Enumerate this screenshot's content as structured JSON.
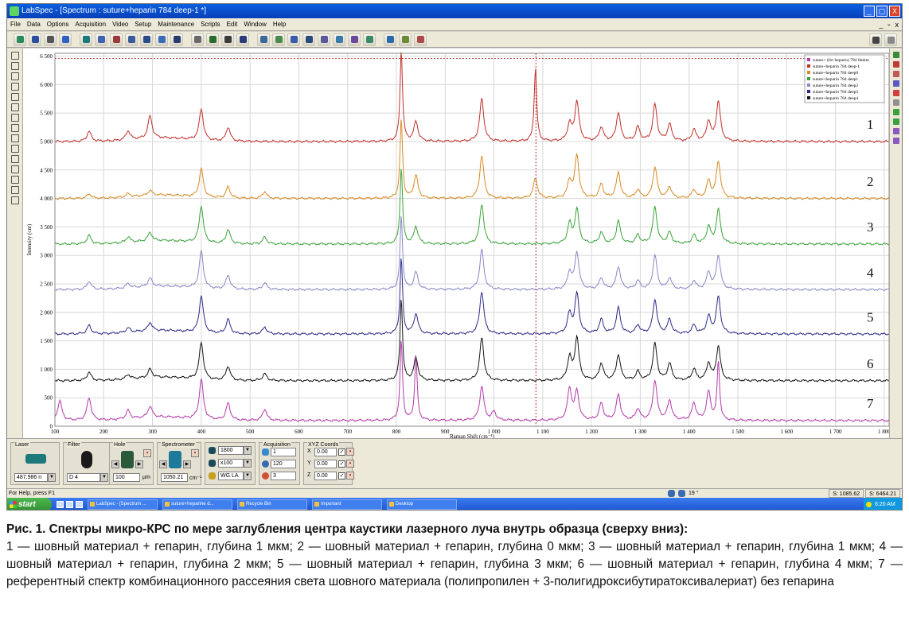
{
  "window": {
    "title": "LabSpec - [Spectrum : suture+heparin 784 deep-1 *]",
    "controls": [
      "_",
      "▢",
      "X"
    ]
  },
  "menu": {
    "items": [
      "File",
      "Data",
      "Options",
      "Acquisition",
      "Video",
      "Setup",
      "Maintenance",
      "Scripts",
      "Edit",
      "Window",
      "Help"
    ],
    "mdi_controls": [
      "_",
      "▫",
      "x"
    ]
  },
  "chart_data": {
    "type": "line",
    "xlabel": "Raman Shift (cm⁻¹)",
    "ylabel": "Intensity (cnt)",
    "xlim": [
      100,
      1810
    ],
    "ylim": [
      0,
      6550
    ],
    "x_ticks": [
      100,
      200,
      300,
      400,
      500,
      600,
      700,
      800,
      900,
      1000,
      1100,
      1200,
      1300,
      1400,
      1500,
      1600,
      1700,
      1800
    ],
    "x_tick_labels": [
      "100",
      "200",
      "300",
      "400",
      "500",
      "600",
      "700",
      "800",
      "900",
      "1 000",
      "1 100",
      "1 200",
      "1 300",
      "1 400",
      "1 500",
      "1 600",
      "1 700",
      "1 800"
    ],
    "y_ticks": [
      0,
      500,
      1000,
      1500,
      2000,
      2500,
      3000,
      3500,
      4000,
      4500,
      5000,
      5500,
      6000,
      6500
    ],
    "y_tick_labels": [
      "0",
      "500",
      "1 000",
      "1 500",
      "2 000",
      "2 500",
      "3 000",
      "3 500",
      "4 000",
      "4 500",
      "5 000",
      "5 500",
      "6 000",
      "6 500"
    ],
    "grid": true,
    "cursor_x": 1086,
    "legend_position": "top-right",
    "series": [
      {
        "name": "suture+heparin 784 deep-1",
        "label": "1",
        "color": "#c0302a",
        "baseline": 5000,
        "scale": 1.0,
        "peaks": [
          [
            170,
            180
          ],
          [
            250,
            160
          ],
          [
            295,
            400
          ],
          [
            400,
            550
          ],
          [
            455,
            250
          ],
          [
            810,
            1600
          ],
          [
            840,
            350
          ],
          [
            975,
            750
          ],
          [
            1085,
            1300
          ],
          [
            1155,
            300
          ],
          [
            1170,
            700
          ],
          [
            1220,
            250
          ],
          [
            1255,
            500
          ],
          [
            1295,
            250
          ],
          [
            1330,
            650
          ],
          [
            1360,
            300
          ],
          [
            1410,
            200
          ],
          [
            1440,
            350
          ],
          [
            1460,
            700
          ]
        ]
      },
      {
        "name": "suture+heparin 784 deep0",
        "label": "2",
        "color": "#d68a22",
        "baseline": 4000,
        "scale": 1.0,
        "peaks": [
          [
            170,
            80
          ],
          [
            250,
            60
          ],
          [
            295,
            90
          ],
          [
            400,
            500
          ],
          [
            455,
            200
          ],
          [
            530,
            120
          ],
          [
            810,
            1400
          ],
          [
            840,
            400
          ],
          [
            975,
            750
          ],
          [
            1085,
            350
          ],
          [
            1155,
            300
          ],
          [
            1170,
            750
          ],
          [
            1220,
            250
          ],
          [
            1255,
            450
          ],
          [
            1295,
            150
          ],
          [
            1330,
            550
          ],
          [
            1360,
            200
          ],
          [
            1410,
            150
          ],
          [
            1440,
            300
          ],
          [
            1460,
            650
          ]
        ]
      },
      {
        "name": "suture+heparin 784 deep1",
        "label": "3",
        "color": "#3aa23a",
        "baseline": 3200,
        "scale": 1.0,
        "peaks": [
          [
            170,
            150
          ],
          [
            250,
            100
          ],
          [
            295,
            150
          ],
          [
            400,
            650
          ],
          [
            455,
            250
          ],
          [
            530,
            120
          ],
          [
            810,
            1350
          ],
          [
            840,
            300
          ],
          [
            975,
            700
          ],
          [
            1155,
            350
          ],
          [
            1170,
            600
          ],
          [
            1220,
            200
          ],
          [
            1255,
            400
          ],
          [
            1295,
            150
          ],
          [
            1330,
            650
          ],
          [
            1360,
            200
          ],
          [
            1410,
            150
          ],
          [
            1440,
            300
          ],
          [
            1460,
            600
          ]
        ]
      },
      {
        "name": "suture+heparin 784 deep2",
        "label": "4",
        "color": "#8a86c8",
        "baseline": 2400,
        "scale": 1.0,
        "peaks": [
          [
            170,
            150
          ],
          [
            250,
            80
          ],
          [
            295,
            150
          ],
          [
            400,
            650
          ],
          [
            455,
            250
          ],
          [
            530,
            120
          ],
          [
            810,
            1300
          ],
          [
            840,
            300
          ],
          [
            975,
            700
          ],
          [
            1155,
            300
          ],
          [
            1170,
            650
          ],
          [
            1220,
            200
          ],
          [
            1255,
            400
          ],
          [
            1295,
            150
          ],
          [
            1330,
            600
          ],
          [
            1360,
            200
          ],
          [
            1410,
            150
          ],
          [
            1440,
            300
          ],
          [
            1460,
            600
          ]
        ]
      },
      {
        "name": "suture+heparin 784 deep3",
        "label": "5",
        "color": "#2a2a88",
        "baseline": 1620,
        "scale": 1.0,
        "peaks": [
          [
            170,
            150
          ],
          [
            250,
            80
          ],
          [
            295,
            150
          ],
          [
            400,
            650
          ],
          [
            455,
            250
          ],
          [
            530,
            120
          ],
          [
            810,
            1350
          ],
          [
            840,
            350
          ],
          [
            975,
            750
          ],
          [
            1155,
            350
          ],
          [
            1170,
            700
          ],
          [
            1220,
            250
          ],
          [
            1255,
            450
          ],
          [
            1295,
            150
          ],
          [
            1330,
            600
          ],
          [
            1360,
            250
          ],
          [
            1410,
            150
          ],
          [
            1440,
            300
          ],
          [
            1460,
            650
          ]
        ]
      },
      {
        "name": "suture+heparin 784 deep4",
        "label": "6",
        "color": "#151515",
        "baseline": 800,
        "scale": 1.0,
        "peaks": [
          [
            170,
            150
          ],
          [
            250,
            80
          ],
          [
            295,
            150
          ],
          [
            400,
            650
          ],
          [
            455,
            250
          ],
          [
            530,
            120
          ],
          [
            810,
            1450
          ],
          [
            840,
            400
          ],
          [
            975,
            750
          ],
          [
            1155,
            400
          ],
          [
            1170,
            750
          ],
          [
            1220,
            300
          ],
          [
            1255,
            450
          ],
          [
            1295,
            150
          ],
          [
            1330,
            650
          ],
          [
            1360,
            300
          ],
          [
            1410,
            200
          ],
          [
            1440,
            300
          ],
          [
            1460,
            600
          ]
        ]
      },
      {
        "name": "suture+ (for heparin) 784 0mkm",
        "label": "7",
        "color": "#b43aaa",
        "baseline": 100,
        "scale": 1.0,
        "peaks": [
          [
            110,
            350
          ],
          [
            170,
            400
          ],
          [
            250,
            150
          ],
          [
            295,
            200
          ],
          [
            400,
            700
          ],
          [
            455,
            300
          ],
          [
            530,
            200
          ],
          [
            810,
            1400
          ],
          [
            840,
            1150
          ],
          [
            975,
            600
          ],
          [
            1000,
            150
          ],
          [
            1155,
            550
          ],
          [
            1170,
            500
          ],
          [
            1220,
            300
          ],
          [
            1255,
            450
          ],
          [
            1295,
            200
          ],
          [
            1330,
            700
          ],
          [
            1360,
            350
          ],
          [
            1410,
            300
          ],
          [
            1440,
            500
          ],
          [
            1460,
            1050
          ]
        ]
      }
    ]
  },
  "panel": {
    "laser": {
      "label": "Laser",
      "value": "487.986 n"
    },
    "filter": {
      "label": "Filter",
      "value": "D 4"
    },
    "hole": {
      "label": "Hole",
      "value": "100",
      "unit": "µm"
    },
    "spectrometer": {
      "label": "Spectrometer",
      "value": "1050.21",
      "unit": "cm⁻¹"
    },
    "grating": {
      "value1": "1800",
      "value2": "x100",
      "value3": "WG LA"
    },
    "acquisition": {
      "label": "Acquisition",
      "value1": "1",
      "value2": "120",
      "value3": "3"
    },
    "xyz": {
      "label": "XYZ Coords",
      "x_label": "X",
      "y_label": "Y",
      "z_label": "Z",
      "x": "0.00",
      "y": "0.00",
      "z": "0.00"
    }
  },
  "status": {
    "help": "For Help, press F1",
    "angle": "19 °",
    "coord_x": "S: 1085.62",
    "coord_y": "S: 6464.21"
  },
  "taskbar": {
    "start": "start",
    "tasks": [
      "LabSpec - [Spectrum ...",
      "suture+heparine d...",
      "Recycle Bin",
      "Important",
      "Desktop"
    ],
    "clock": "6:20 AM"
  },
  "caption": {
    "title": "Рис. 1. Спектры микро-КРС по мере заглубления центра каустики лазерного луча внутрь образца (сверху вниз):",
    "body": "1 — шовный материал + гепарин, глубина 1 мкм; 2 — шовный материал + гепарин, глубина 0 мкм; 3 — шовный материал + гепарин, глубина 1 мкм; 4 — шовный материал + гепарин, глубина 2 мкм; 5 — шовный материал + гепарин, глубина 3 мкм; 6 — шовный материал + гепарин, глубина 4 мкм; 7 — референтный спектр комбинационного рассеяния света шовного материала (полипропилен + 3-полигидроксибутиратоксивалериат) без гепарина"
  }
}
